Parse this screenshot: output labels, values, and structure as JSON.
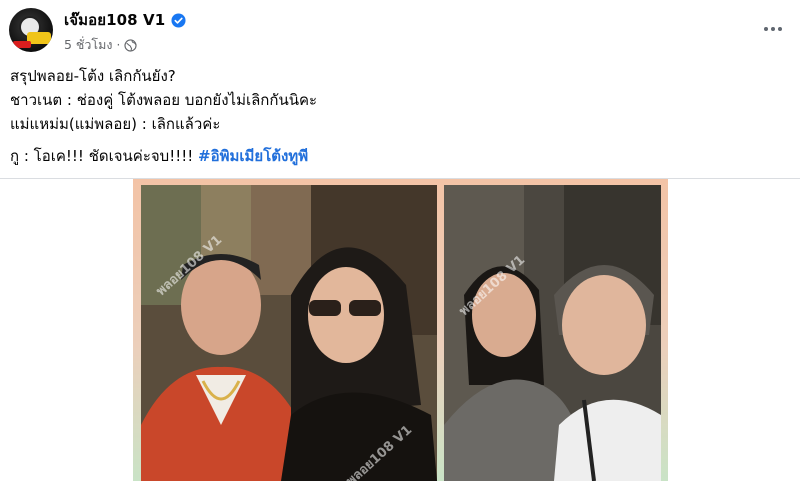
{
  "post": {
    "page_name": "เจ๊มอย108 V1",
    "timestamp": "5 ชั่วโมง",
    "separator": "·",
    "verified_icon": "verified-badge-icon",
    "privacy_icon": "globe-icon",
    "more_icon": "more-options-icon",
    "lines": [
      "สรุปพลอย-โต้ง เลิกกันยัง?",
      "ชาวเนต : ช่องคู่ โต้งพลอย บอกยังไม่เลิกกันนิคะ",
      "แม่แหม่ม(แม่พลอย) : เลิกแล้วค่ะ"
    ],
    "last_line_text": "กู : โอเค!!! ชัดเจนค่ะจบ!!!! ",
    "hashtag": "#อิพิมเมียโต้งทูพี",
    "colors": {
      "hashtag": "#216fdb",
      "verified": "#1877f2",
      "secondary_text": "#65676b"
    }
  },
  "image": {
    "watermark_text": "พลอย108 V1"
  }
}
